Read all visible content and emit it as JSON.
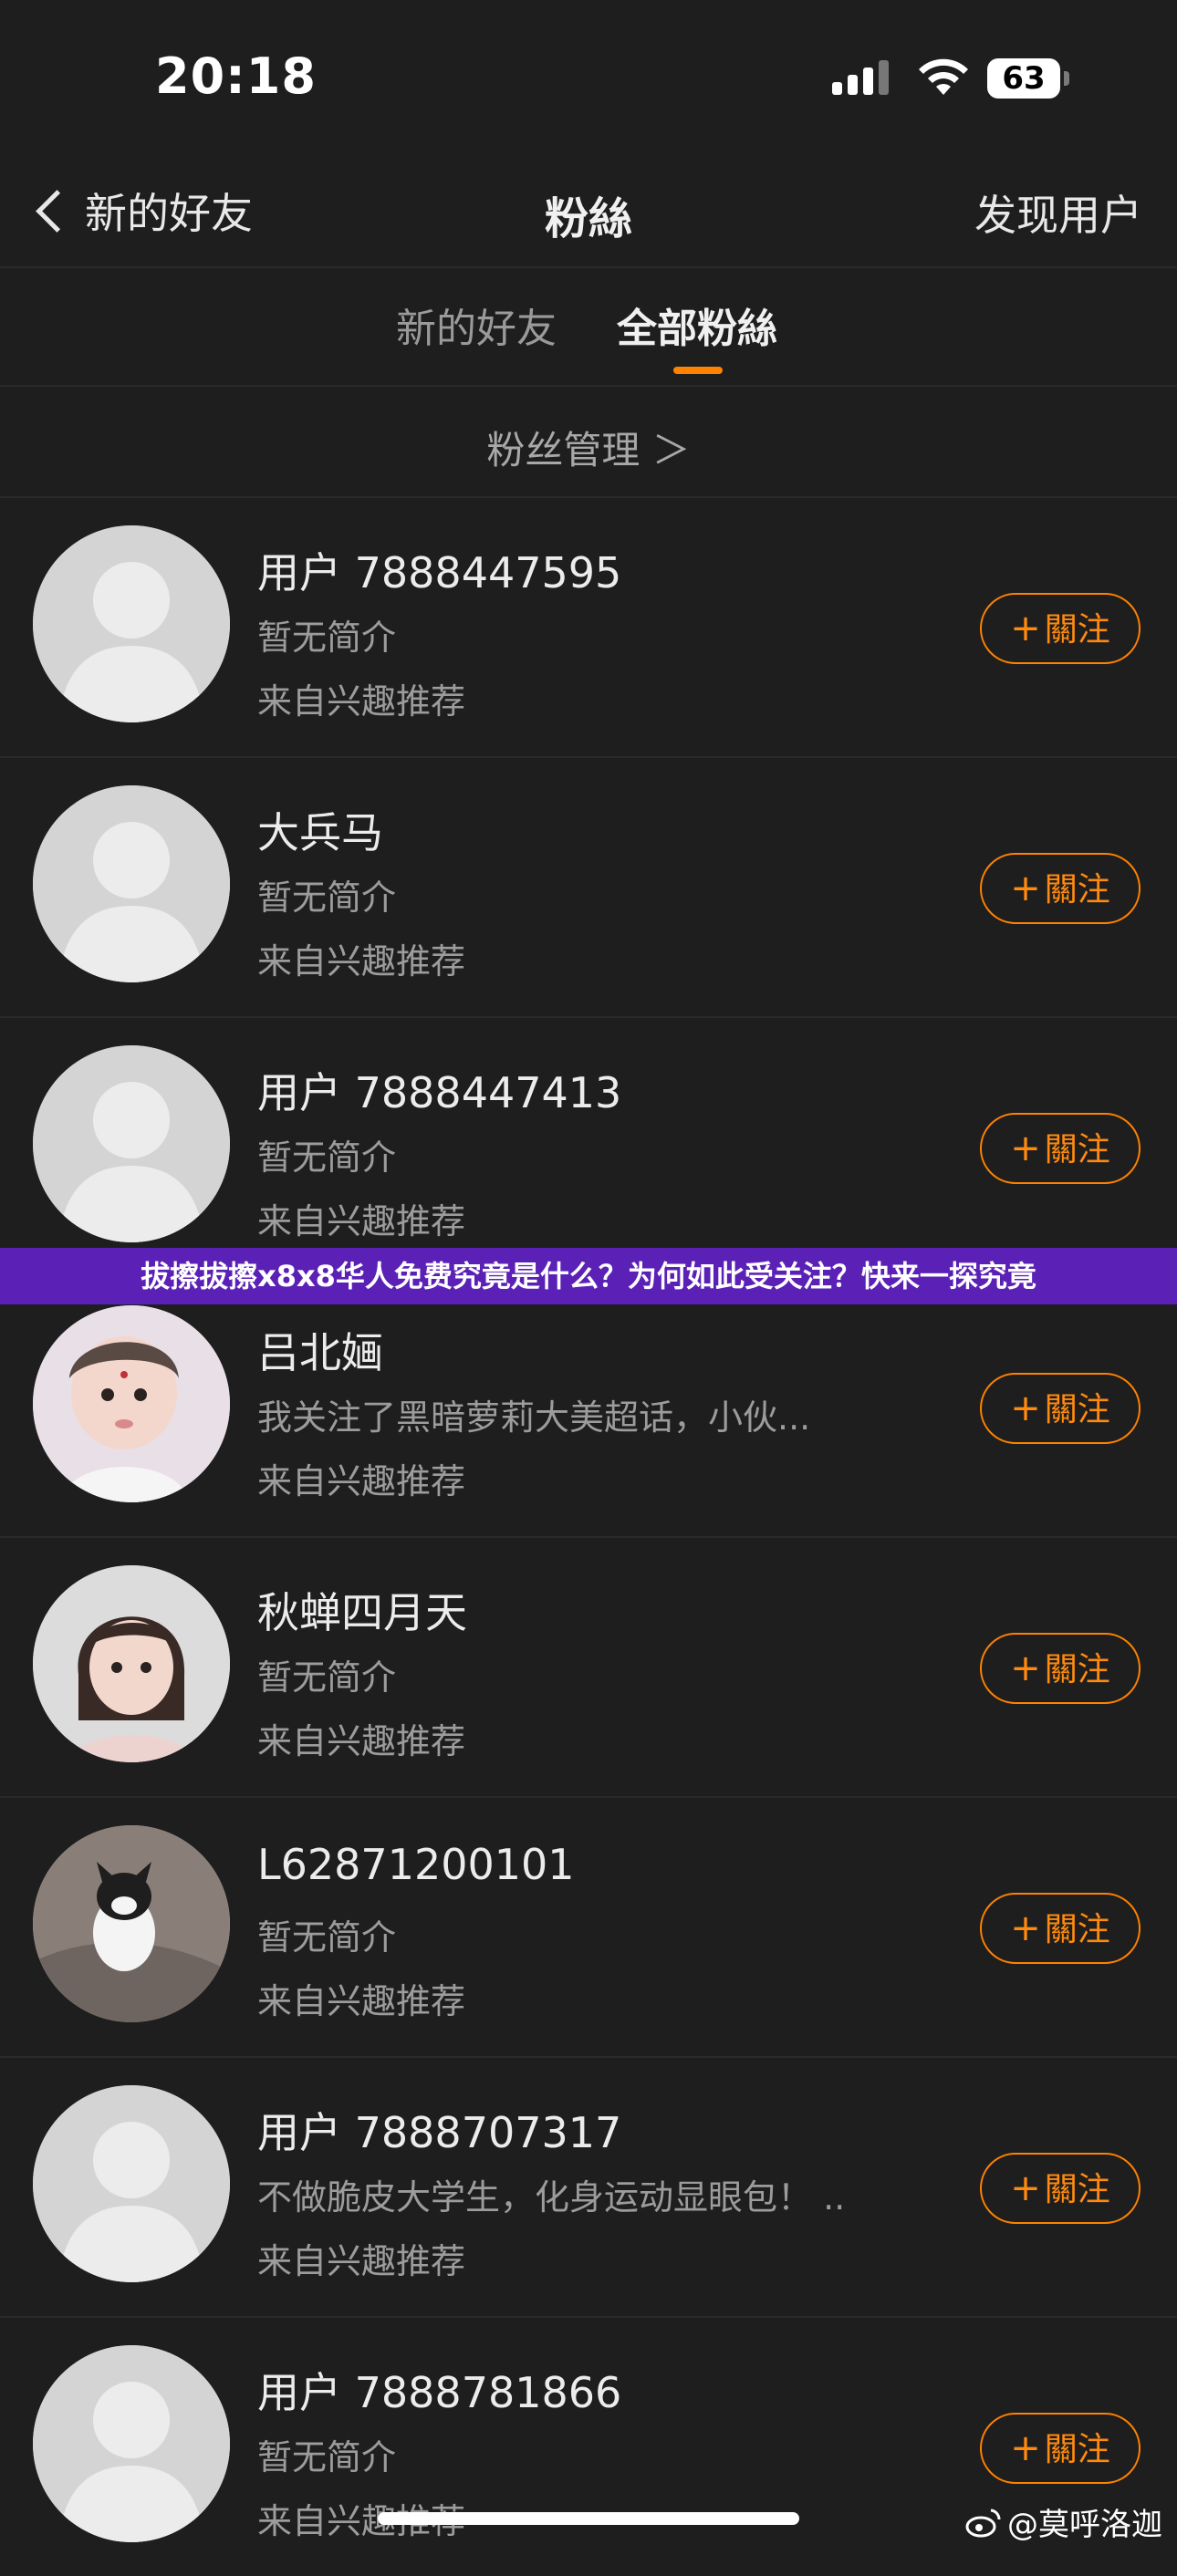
{
  "status_bar": {
    "time": "20:18",
    "battery": "63"
  },
  "nav": {
    "back_label": "新的好友",
    "title": "粉絲",
    "right_label": "发现用户"
  },
  "tabs": [
    {
      "label": "新的好友",
      "active": false
    },
    {
      "label": "全部粉絲",
      "active": true
    }
  ],
  "manage": {
    "label": "粉丝管理 ＞"
  },
  "follow_label": "關注",
  "users": [
    {
      "name": "用户 7888447595",
      "bio": "暂无简介",
      "source": "来自兴趣推荐",
      "avatar": "default-avatar"
    },
    {
      "name": "大兵马",
      "bio": "暂无简介",
      "source": "来自兴趣推荐",
      "avatar": "default-avatar"
    },
    {
      "name": "用户 7888447413",
      "bio": "暂无简介",
      "source": "来自兴趣推荐",
      "avatar": "default-avatar"
    },
    {
      "name": "吕北婳",
      "bio": "我关注了黑暗萝莉大美超话，小伙...",
      "source": "来自兴趣推荐",
      "avatar": "baby-photo"
    },
    {
      "name": "秋蝉四月天",
      "bio": "暂无简介",
      "source": "来自兴趣推荐",
      "avatar": "girl-photo"
    },
    {
      "name": "L62871200101",
      "bio": "暂无简介",
      "source": "来自兴趣推荐",
      "avatar": "cat-photo"
    },
    {
      "name": "用户 7888707317",
      "bio": "不做脆皮大学生，化身运动显眼包！ ..",
      "source": "来自兴趣推荐",
      "avatar": "default-avatar"
    },
    {
      "name": "用户 7888781866",
      "bio": "暂无简介",
      "source": "来自兴趣推荐",
      "avatar": "default-avatar"
    }
  ],
  "banner": {
    "text": "拔擦拔擦x8x8华人免费究竟是什么？为何如此受关注？快来一探究竟"
  },
  "watermark": {
    "text": "@莫呼洛迦"
  },
  "colors": {
    "accent": "#ff8200",
    "background": "#1e1e1e",
    "banner": "#5b21b6"
  }
}
